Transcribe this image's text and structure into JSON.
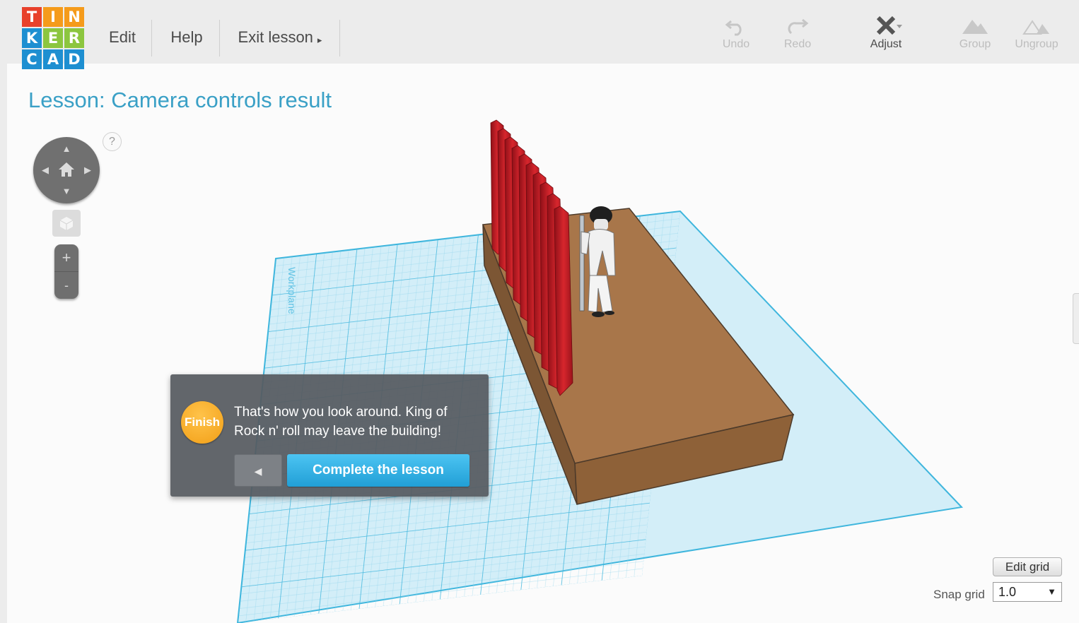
{
  "logo": {
    "letters": [
      "T",
      "I",
      "N",
      "K",
      "E",
      "R",
      "C",
      "A",
      "D"
    ],
    "colors": [
      "#e8412b",
      "#f59b1b",
      "#f59b1b",
      "#1e8fd1",
      "#8cc63f",
      "#8cc63f",
      "#1e8fd1",
      "#1e8fd1",
      "#1e8fd1"
    ]
  },
  "menu": {
    "edit": "Edit",
    "help": "Help",
    "exit_lesson": "Exit lesson",
    "exit_arrow": "▸"
  },
  "toolbar": {
    "undo": "Undo",
    "redo": "Redo",
    "adjust": "Adjust",
    "group": "Group",
    "ungroup": "Ungroup"
  },
  "lesson": {
    "title": "Lesson: Camera controls result",
    "badge": "Finish",
    "message": "That's how you look around. King of Rock n' roll may leave the building!",
    "back_symbol": "◀",
    "complete_button": "Complete the lesson"
  },
  "view_controls": {
    "help_symbol": "?",
    "zoom_in": "+",
    "zoom_out": "-"
  },
  "scene": {
    "workplane_label": "Workplane",
    "grid_color": "#3fb6dd",
    "platform_color": "#a8764a",
    "curtain_color": "#c81e25"
  },
  "grid_controls": {
    "edit_grid": "Edit grid",
    "snap_label": "Snap grid",
    "snap_value": "1.0",
    "snap_caret": "▼"
  }
}
